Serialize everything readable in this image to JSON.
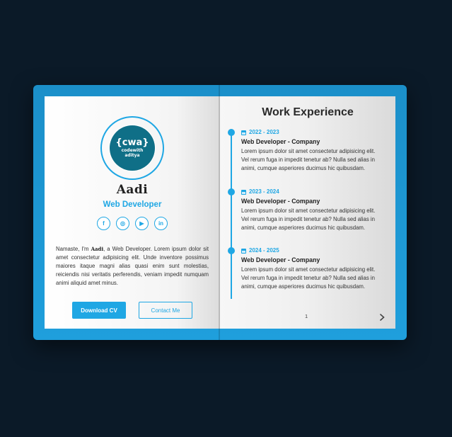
{
  "profile": {
    "logo_main": "{cwa}",
    "logo_sub_1": "codewith",
    "logo_sub_2": "aditya",
    "signature": "Aadi",
    "role": "Web Developer",
    "socials": [
      {
        "icon": "facebook-icon",
        "glyph": "f"
      },
      {
        "icon": "instagram-icon",
        "glyph": "◎"
      },
      {
        "icon": "youtube-icon",
        "glyph": "▶"
      },
      {
        "icon": "linkedin-icon",
        "glyph": "in"
      }
    ],
    "bio_before": "Namaste, I'm",
    "bio_brand": "Aadi",
    "bio_after": ", a Web Developer. Lorem ipsum dolor sit amet consectetur adipisicing elit. Unde inventore possimus maiores itaque magni alias quasi enim sunt molestias, reiciendis nisi veritatis perferendis, veniam impedit numquam animi aliquid amet minus.",
    "download_label": "Download CV",
    "contact_label": "Contact Me"
  },
  "experience": {
    "title": "Work Experience",
    "entries": [
      {
        "date": "2022 - 2023",
        "job": "Web Developer - Company",
        "desc": "Lorem ipsum dolor sit amet consectetur adipisicing elit. Vel rerum fuga in impedit tenetur ab? Nulla sed alias in animi, cumque asperiores ducimus hic quibusdam."
      },
      {
        "date": "2023 - 2024",
        "job": "Web Developer - Company",
        "desc": "Lorem ipsum dolor sit amet consectetur adipisicing elit. Vel rerum fuga in impedit tenetur ab? Nulla sed alias in animi, cumque asperiores ducimus hic quibusdam."
      },
      {
        "date": "2024 - 2025",
        "job": "Web Developer - Company",
        "desc": "Lorem ipsum dolor sit amet consectetur adipisicing elit. Vel rerum fuga in impedit tenetur ab? Nulla sed alias in animi, cumque asperiores ducimus hic quibusdam."
      }
    ],
    "page_number": "1"
  },
  "colors": {
    "background": "#0b1a28",
    "accent": "#1fa7e4",
    "book_cover": "#1f9fdc",
    "logo_bg": "#0f6f87"
  }
}
